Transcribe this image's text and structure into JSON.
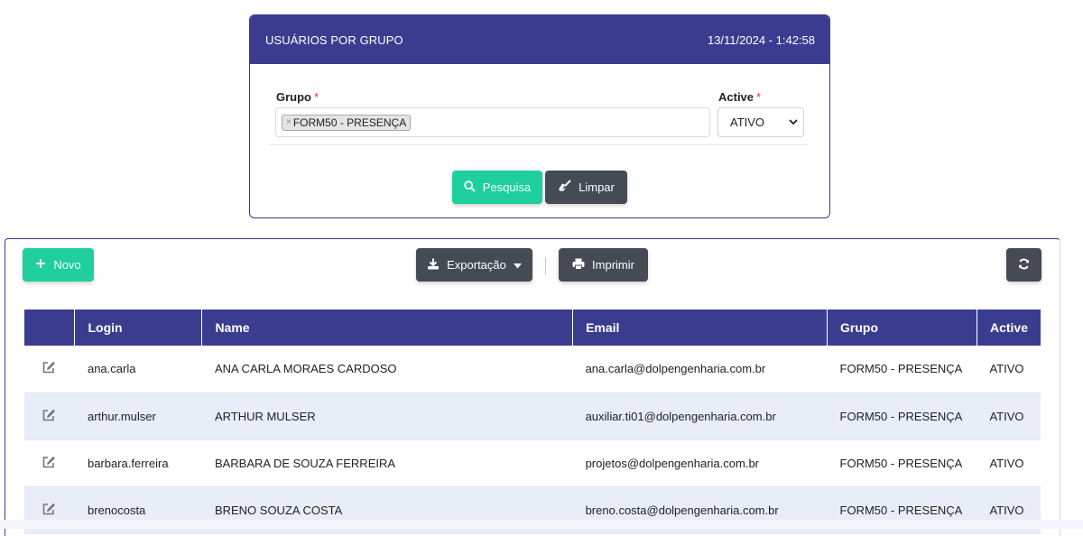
{
  "filter": {
    "title": "USUÁRIOS POR GRUPO",
    "datetime": "13/11/2024 - 1:42:58",
    "grupo_label": "Grupo",
    "required_mark": "*",
    "grupo_tag": "FORM50 - PRESENÇA",
    "grupo_tag_remove": "×",
    "active_label": "Active",
    "active_value": "ATIVO",
    "search_label": "Pesquisa",
    "clear_label": "Limpar"
  },
  "toolbar": {
    "new_label": "Novo",
    "export_label": "Exportação",
    "print_label": "Imprimir"
  },
  "table": {
    "columns": [
      "",
      "Login",
      "Name",
      "Email",
      "Grupo",
      "Active"
    ],
    "rows": [
      {
        "login": "ana.carla",
        "name": "ANA CARLA MORAES CARDOSO",
        "email": "ana.carla@dolpengenharia.com.br",
        "grupo": "FORM50 - PRESENÇA",
        "active": "ATIVO"
      },
      {
        "login": "arthur.mulser",
        "name": "ARTHUR MULSER",
        "email": "auxiliar.ti01@dolpengenharia.com.br",
        "grupo": "FORM50 - PRESENÇA",
        "active": "ATIVO"
      },
      {
        "login": "barbara.ferreira",
        "name": "BARBARA DE SOUZA FERREIRA",
        "email": "projetos@dolpengenharia.com.br",
        "grupo": "FORM50 - PRESENÇA",
        "active": "ATIVO"
      },
      {
        "login": "brenocosta",
        "name": "BRENO SOUZA COSTA",
        "email": "breno.costa@dolpengenharia.com.br",
        "grupo": "FORM50 - PRESENÇA",
        "active": "ATIVO"
      }
    ]
  },
  "icons": {
    "search": "search-icon",
    "broom": "broom-icon",
    "plus": "plus-icon",
    "download": "download-icon",
    "caret": "caret-down-icon",
    "print": "print-icon",
    "refresh": "refresh-icon",
    "edit": "edit-icon"
  },
  "colors": {
    "primary": "#3a3d8f",
    "success": "#1fcf9d",
    "dark": "#444b55",
    "row_alt": "#e8edf8"
  }
}
